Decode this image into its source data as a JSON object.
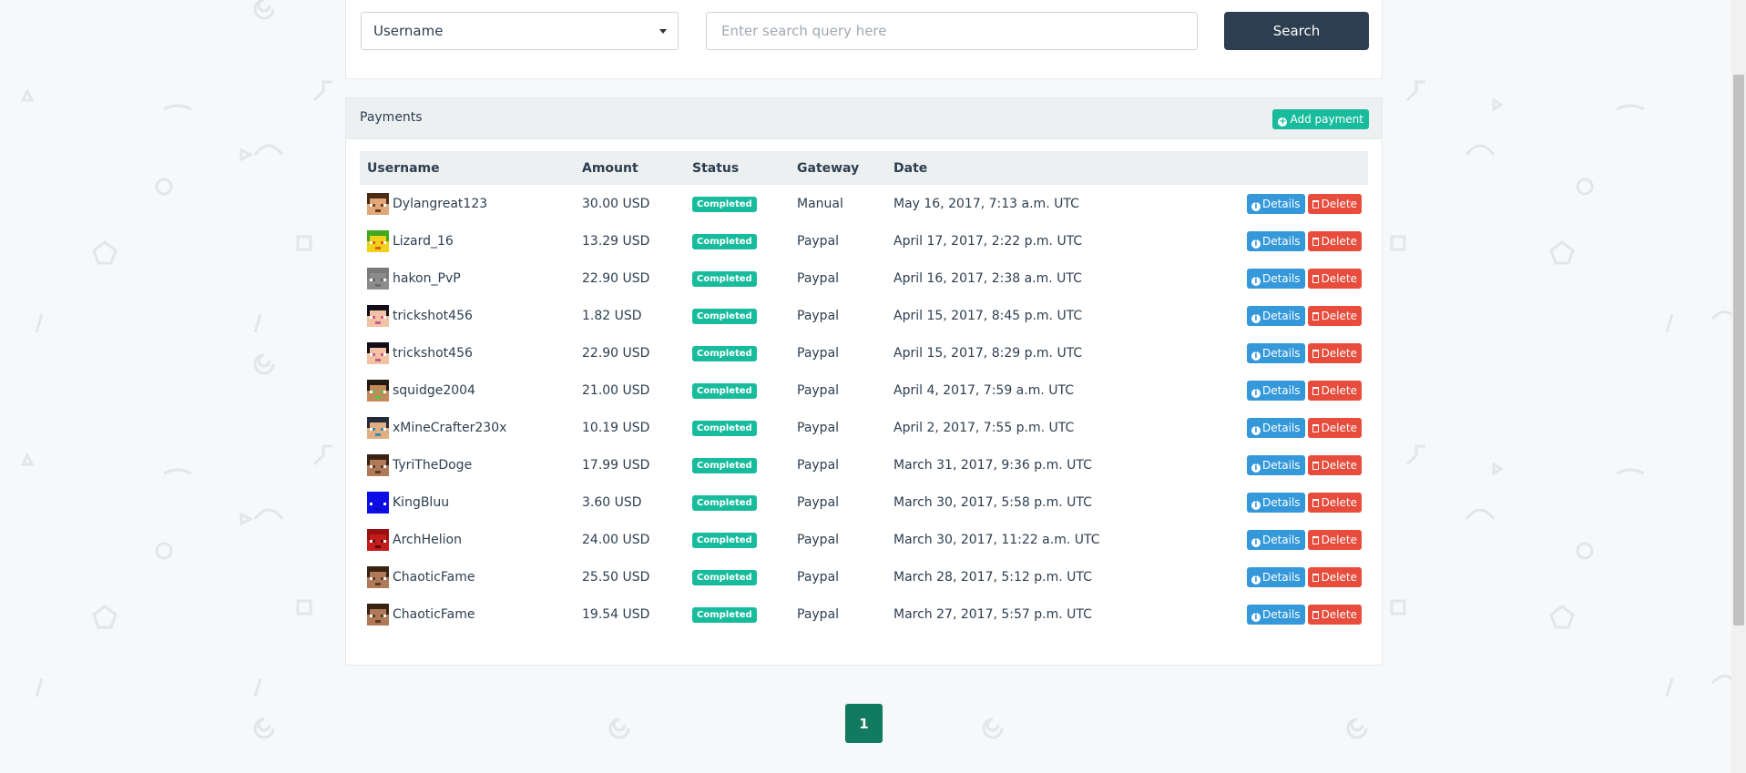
{
  "search": {
    "field_selected": "Username",
    "placeholder": "Enter search query here",
    "button_label": "Search"
  },
  "payments": {
    "title": "Payments",
    "add_label": "Add payment",
    "columns": [
      "Username",
      "Amount",
      "Status",
      "Gateway",
      "Date"
    ],
    "details_label": "Details",
    "delete_label": "Delete",
    "rows": [
      {
        "username": "Dylangreat123",
        "amount": "30.00 USD",
        "status": "Completed",
        "gateway": "Manual",
        "date": "May 16, 2017, 7:13 a.m. UTC",
        "skin": "skin-dylan"
      },
      {
        "username": "Lizard_16",
        "amount": "13.29 USD",
        "status": "Completed",
        "gateway": "Paypal",
        "date": "April 17, 2017, 2:22 p.m. UTC",
        "skin": "skin-lizard"
      },
      {
        "username": "hakon_PvP",
        "amount": "22.90 USD",
        "status": "Completed",
        "gateway": "Paypal",
        "date": "April 16, 2017, 2:38 a.m. UTC",
        "skin": "skin-gray"
      },
      {
        "username": "trickshot456",
        "amount": "1.82 USD",
        "status": "Completed",
        "gateway": "Paypal",
        "date": "April 15, 2017, 8:45 p.m. UTC",
        "skin": "skin-trick"
      },
      {
        "username": "trickshot456",
        "amount": "22.90 USD",
        "status": "Completed",
        "gateway": "Paypal",
        "date": "April 15, 2017, 8:29 p.m. UTC",
        "skin": "skin-trick"
      },
      {
        "username": "squidge2004",
        "amount": "21.00 USD",
        "status": "Completed",
        "gateway": "Paypal",
        "date": "April 4, 2017, 7:59 a.m. UTC",
        "skin": "skin-squidge"
      },
      {
        "username": "xMineCrafter230x",
        "amount": "10.19 USD",
        "status": "Completed",
        "gateway": "Paypal",
        "date": "April 2, 2017, 7:55 p.m. UTC",
        "skin": "skin-xmine"
      },
      {
        "username": "TyriTheDoge",
        "amount": "17.99 USD",
        "status": "Completed",
        "gateway": "Paypal",
        "date": "March 31, 2017, 9:36 p.m. UTC",
        "skin": "skin-steve"
      },
      {
        "username": "KingBluu",
        "amount": "3.60 USD",
        "status": "Completed",
        "gateway": "Paypal",
        "date": "March 30, 2017, 5:58 p.m. UTC",
        "skin": "skin-blue"
      },
      {
        "username": "ArchHelion",
        "amount": "24.00 USD",
        "status": "Completed",
        "gateway": "Paypal",
        "date": "March 30, 2017, 11:22 a.m. UTC",
        "skin": "skin-red"
      },
      {
        "username": "ChaoticFame",
        "amount": "25.50 USD",
        "status": "Completed",
        "gateway": "Paypal",
        "date": "March 28, 2017, 5:12 p.m. UTC",
        "skin": "skin-steve"
      },
      {
        "username": "ChaoticFame",
        "amount": "19.54 USD",
        "status": "Completed",
        "gateway": "Paypal",
        "date": "March 27, 2017, 5:57 p.m. UTC",
        "skin": "skin-steve"
      }
    ]
  },
  "pagination": {
    "current": "1"
  },
  "colors": {
    "primary_dark": "#2c3e50",
    "success": "#18bc9c",
    "info": "#3498db",
    "danger": "#e74c3c",
    "page_active": "#127a61"
  }
}
